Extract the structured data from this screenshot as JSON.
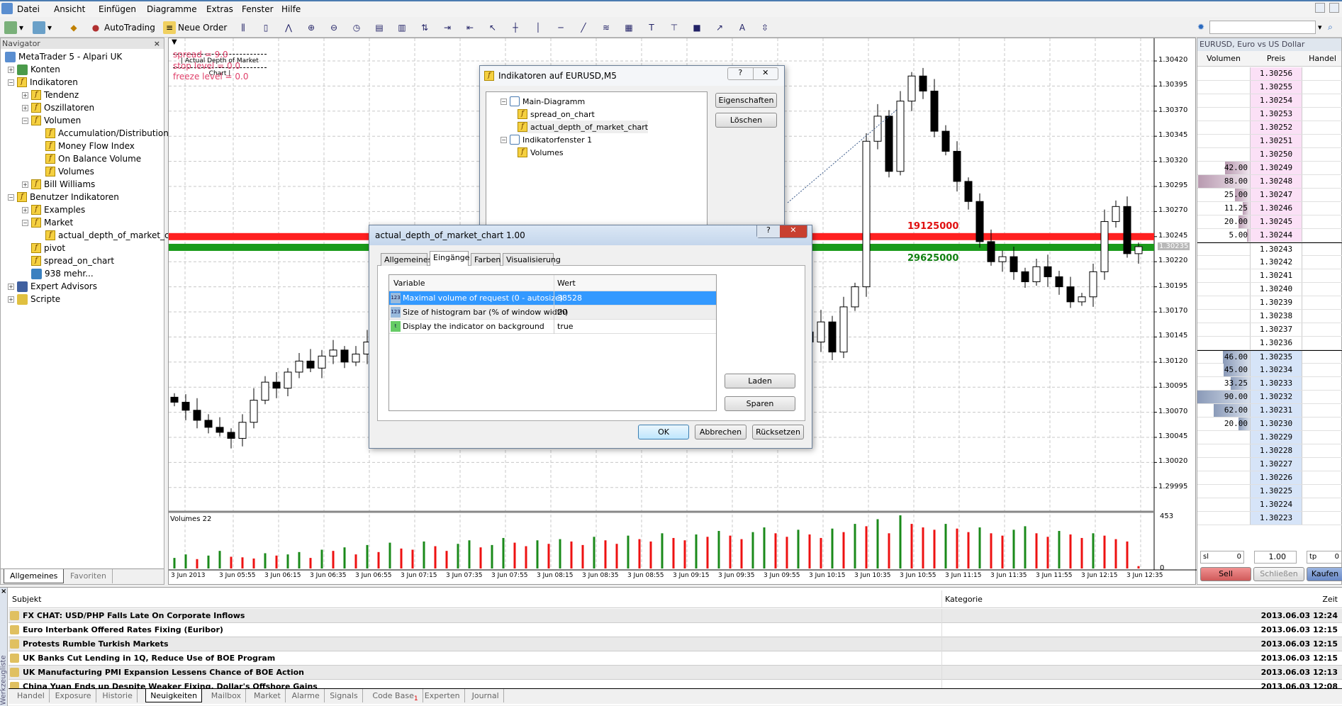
{
  "menu": [
    "Datei",
    "Ansicht",
    "Einfügen",
    "Diagramme",
    "Extras",
    "Fenster",
    "Hilfe"
  ],
  "toolbar": {
    "autotrading": "AutoTrading",
    "new_order": "Neue Order"
  },
  "navigator": {
    "title": "Navigator",
    "items": [
      {
        "label": "MetaTrader 5 - Alpari UK",
        "level": 0,
        "icon": "terminal-icon",
        "toggle": ""
      },
      {
        "label": "Konten",
        "level": 1,
        "icon": "accounts-icon",
        "toggle": "+"
      },
      {
        "label": "Indikatoren",
        "level": 1,
        "icon": "indicator-icon",
        "toggle": "-"
      },
      {
        "label": "Tendenz",
        "level": 2,
        "icon": "indicator-icon",
        "toggle": "+"
      },
      {
        "label": "Oszillatoren",
        "level": 2,
        "icon": "indicator-icon",
        "toggle": "+"
      },
      {
        "label": "Volumen",
        "level": 2,
        "icon": "indicator-icon",
        "toggle": "-"
      },
      {
        "label": "Accumulation/Distribution",
        "level": 3,
        "icon": "indicator-icon",
        "toggle": ""
      },
      {
        "label": "Money Flow Index",
        "level": 3,
        "icon": "indicator-icon",
        "toggle": ""
      },
      {
        "label": "On Balance Volume",
        "level": 3,
        "icon": "indicator-icon",
        "toggle": ""
      },
      {
        "label": "Volumes",
        "level": 3,
        "icon": "indicator-icon",
        "toggle": ""
      },
      {
        "label": "Bill Williams",
        "level": 2,
        "icon": "indicator-icon",
        "toggle": "+"
      },
      {
        "label": "Benutzer Indikatoren",
        "level": 1,
        "icon": "custom-indicator-icon",
        "toggle": "-"
      },
      {
        "label": "Examples",
        "level": 2,
        "icon": "custom-indicator-icon",
        "toggle": "+"
      },
      {
        "label": "Market",
        "level": 2,
        "icon": "custom-indicator-icon",
        "toggle": "-"
      },
      {
        "label": "actual_depth_of_market_chart",
        "level": 3,
        "icon": "custom-indicator-icon",
        "toggle": ""
      },
      {
        "label": "pivot",
        "level": 2,
        "icon": "custom-indicator-icon",
        "toggle": ""
      },
      {
        "label": "spread_on_chart",
        "level": 2,
        "icon": "custom-indicator-icon",
        "toggle": ""
      },
      {
        "label": "938 mehr...",
        "level": 2,
        "icon": "market-icon",
        "toggle": ""
      },
      {
        "label": "Expert Advisors",
        "level": 1,
        "icon": "expert-icon",
        "toggle": "+"
      },
      {
        "label": "Scripte",
        "level": 1,
        "icon": "script-icon",
        "toggle": "+"
      }
    ],
    "tabs": [
      "Allgemeines",
      "Favoriten"
    ]
  },
  "chart": {
    "info_title": "| Actual Depth of Market Chart |",
    "spread": "spread = 9.0",
    "stop_level": "stop level = 0.0",
    "freeze_level": "freeze level = 0.0",
    "ask_volume_label": "19125000",
    "bid_volume_label": "29625000",
    "ask_line_price": 1.30245,
    "bid_line_price": 1.30235,
    "current_price": "1.30235",
    "price_ticks": [
      "1.30420",
      "1.30395",
      "1.30370",
      "1.30345",
      "1.30320",
      "1.30295",
      "1.30270",
      "1.30245",
      "1.30220",
      "1.30195",
      "1.30170",
      "1.30145",
      "1.30120",
      "1.30095",
      "1.30070",
      "1.30045",
      "1.30020",
      "1.29995"
    ],
    "time_ticks": [
      "3 Jun 2013",
      "3 Jun 05:55",
      "3 Jun 06:15",
      "3 Jun 06:35",
      "3 Jun 06:55",
      "3 Jun 07:15",
      "3 Jun 07:35",
      "3 Jun 07:55",
      "3 Jun 08:15",
      "3 Jun 08:35",
      "3 Jun 08:55",
      "3 Jun 09:15",
      "3 Jun 09:35",
      "3 Jun 09:55",
      "3 Jun 10:15",
      "3 Jun 10:35",
      "3 Jun 10:55",
      "3 Jun 11:15",
      "3 Jun 11:35",
      "3 Jun 11:55",
      "3 Jun 12:15",
      "3 Jun 12:35"
    ],
    "closes": [
      1.3008,
      1.30072,
      1.30062,
      1.30055,
      1.3005,
      1.30044,
      1.3006,
      1.30082,
      1.301,
      1.30094,
      1.3011,
      1.30121,
      1.30114,
      1.30126,
      1.30132,
      1.3012,
      1.30128,
      1.3014,
      1.30135,
      1.3015,
      1.30142,
      1.30155,
      1.3016,
      1.3015,
      1.30165,
      1.30172,
      1.3016,
      1.3017,
      1.3018,
      1.30168,
      1.30175,
      1.30185,
      1.30178,
      1.3019,
      1.30182,
      1.30195,
      1.30188,
      1.30176,
      1.30184,
      1.3017,
      1.30178,
      1.30165,
      1.30172,
      1.3016,
      1.30168,
      1.30155,
      1.30162,
      1.3015,
      1.30158,
      1.30165,
      1.30152,
      1.3016,
      1.3017,
      1.30158,
      1.30166,
      1.3015,
      1.3014,
      1.3016,
      1.3013,
      1.30175,
      1.30195,
      1.3034,
      1.30365,
      1.3031,
      1.3038,
      1.30405,
      1.3039,
      1.3035,
      1.3033,
      1.303,
      1.3028,
      1.3024,
      1.3022,
      1.30225,
      1.3021,
      1.302,
      1.30215,
      1.30205,
      1.30195,
      1.3018,
      1.30185,
      1.3021,
      1.3026,
      1.30275,
      1.30228,
      1.30235
    ],
    "volumes_label": "Volumes 22",
    "volumes_max": "453",
    "volumes_min": "0",
    "volumes": [
      90,
      120,
      80,
      110,
      150,
      100,
      95,
      85,
      130,
      110,
      120,
      140,
      90,
      160,
      150,
      180,
      120,
      200,
      140,
      220,
      170,
      160,
      230,
      190,
      150,
      210,
      240,
      180,
      200,
      260,
      220,
      190,
      240,
      210,
      250,
      230,
      200,
      270,
      240,
      210,
      280,
      250,
      230,
      300,
      260,
      240,
      290,
      270,
      320,
      280,
      250,
      310,
      350,
      300,
      270,
      330,
      290,
      260,
      340,
      310,
      380,
      360,
      420,
      300,
      453,
      380,
      350,
      330,
      380,
      340,
      310,
      350,
      300,
      280,
      330,
      360,
      300,
      270,
      320,
      290,
      260,
      300,
      280,
      250,
      230,
      20
    ],
    "colors": {
      "bull": "#ffffff",
      "bear": "#000000",
      "ask_line": "#ff2020",
      "bid_line": "#1a9a1a",
      "vol_up": "#1a8a1a",
      "vol_down": "#ee1111",
      "info_text": "#e0406a"
    }
  },
  "depth": {
    "title": "EURUSD, Euro vs US Dollar",
    "columns": [
      "Volumen",
      "Preis",
      "Handel"
    ],
    "rows": [
      {
        "price": "1.30256",
        "vol": "",
        "side": "ask",
        "fill": 0
      },
      {
        "price": "1.30255",
        "vol": "",
        "side": "ask",
        "fill": 0
      },
      {
        "price": "1.30254",
        "vol": "",
        "side": "ask",
        "fill": 0
      },
      {
        "price": "1.30253",
        "vol": "",
        "side": "ask",
        "fill": 0
      },
      {
        "price": "1.30252",
        "vol": "",
        "side": "ask",
        "fill": 0
      },
      {
        "price": "1.30251",
        "vol": "",
        "side": "ask",
        "fill": 0
      },
      {
        "price": "1.30250",
        "vol": "",
        "side": "ask",
        "fill": 0
      },
      {
        "price": "1.30249",
        "vol": "42.00",
        "side": "ask",
        "fill": 0.47
      },
      {
        "price": "1.30248",
        "vol": "88.00",
        "side": "ask",
        "fill": 0.98
      },
      {
        "price": "1.30247",
        "vol": "25.00",
        "side": "ask",
        "fill": 0.28
      },
      {
        "price": "1.30246",
        "vol": "11.25",
        "side": "ask",
        "fill": 0.13
      },
      {
        "price": "1.30245",
        "vol": "20.00",
        "side": "ask",
        "fill": 0.22
      },
      {
        "price": "1.30244",
        "vol": "5.00",
        "side": "ask",
        "fill": 0.06
      },
      {
        "price": "1.30243",
        "vol": "",
        "side": "none",
        "fill": 0
      },
      {
        "price": "1.30242",
        "vol": "",
        "side": "none",
        "fill": 0
      },
      {
        "price": "1.30241",
        "vol": "",
        "side": "none",
        "fill": 0
      },
      {
        "price": "1.30240",
        "vol": "",
        "side": "none",
        "fill": 0
      },
      {
        "price": "1.30239",
        "vol": "",
        "side": "none",
        "fill": 0
      },
      {
        "price": "1.30238",
        "vol": "",
        "side": "none",
        "fill": 0
      },
      {
        "price": "1.30237",
        "vol": "",
        "side": "none",
        "fill": 0
      },
      {
        "price": "1.30236",
        "vol": "",
        "side": "none",
        "fill": 0
      },
      {
        "price": "1.30235",
        "vol": "46.00",
        "side": "bid",
        "fill": 0.51
      },
      {
        "price": "1.30234",
        "vol": "45.00",
        "side": "bid",
        "fill": 0.5
      },
      {
        "price": "1.30233",
        "vol": "33.25",
        "side": "bid",
        "fill": 0.37
      },
      {
        "price": "1.30232",
        "vol": "90.00",
        "side": "bid",
        "fill": 1.0
      },
      {
        "price": "1.30231",
        "vol": "62.00",
        "side": "bid",
        "fill": 0.69
      },
      {
        "price": "1.30230",
        "vol": "20.00",
        "side": "bid",
        "fill": 0.22
      },
      {
        "price": "1.30229",
        "vol": "",
        "side": "bid",
        "fill": 0
      },
      {
        "price": "1.30228",
        "vol": "",
        "side": "bid",
        "fill": 0
      },
      {
        "price": "1.30227",
        "vol": "",
        "side": "bid",
        "fill": 0
      },
      {
        "price": "1.30226",
        "vol": "",
        "side": "bid",
        "fill": 0
      },
      {
        "price": "1.30225",
        "vol": "",
        "side": "bid",
        "fill": 0
      },
      {
        "price": "1.30224",
        "vol": "",
        "side": "bid",
        "fill": 0
      },
      {
        "price": "1.30223",
        "vol": "",
        "side": "bid",
        "fill": 0
      }
    ],
    "sl_label": "sl",
    "sl_value": "0",
    "lot": "1.00",
    "tp_label": "tp",
    "tp_value": "0",
    "sell": "Sell",
    "close": "Schließen",
    "buy": "Kaufen"
  },
  "indicators_dialog": {
    "title": "Indikatoren auf EURUSD,M5",
    "tree": [
      {
        "label": "Main-Diagramm",
        "level": 0,
        "icon": "window-icon"
      },
      {
        "label": "spread_on_chart",
        "level": 1,
        "icon": "custom-indicator-icon"
      },
      {
        "label": "actual_depth_of_market_chart",
        "level": 1,
        "icon": "custom-indicator-icon"
      },
      {
        "label": "Indikatorfenster 1",
        "level": 0,
        "icon": "window-icon"
      },
      {
        "label": "Volumes",
        "level": 1,
        "icon": "indicator-icon"
      }
    ],
    "properties": "Eigenschaften",
    "delete": "Löschen"
  },
  "props_dialog": {
    "title": "actual_depth_of_market_chart 1.00",
    "tabs": [
      "Allgemeines",
      "Eingänge",
      "Farben",
      "Visualisierung"
    ],
    "active_tab": 1,
    "columns": [
      "Variable",
      "Wert"
    ],
    "rows": [
      {
        "name": "Maximal volume of request (0 - autosize)",
        "value": "38528",
        "type": "int",
        "selected": true
      },
      {
        "name": "Size of histogram bar (% of window width)",
        "value": "20",
        "type": "int",
        "selected": false
      },
      {
        "name": "Display the indicator on background",
        "value": "true",
        "type": "bool",
        "selected": false
      }
    ],
    "load": "Laden",
    "save": "Sparen",
    "ok": "OK",
    "cancel": "Abbrechen",
    "reset": "Rücksetzen"
  },
  "toolbox": {
    "side_label": "Werkzeugliste",
    "columns": [
      "Subjekt",
      "Kategorie",
      "Zeit"
    ],
    "news": [
      {
        "subject": "FX CHAT: USD/PHP Falls Late On Corporate Inflows",
        "category": "",
        "time": "2013.06.03 12:24"
      },
      {
        "subject": "Euro Interbank Offered Rates Fixing (Euribor)",
        "category": "",
        "time": "2013.06.03 12:15"
      },
      {
        "subject": "Protests Rumble Turkish Markets",
        "category": "",
        "time": "2013.06.03 12:15"
      },
      {
        "subject": "UK Banks Cut Lending in 1Q, Reduce Use of BOE Program",
        "category": "",
        "time": "2013.06.03 12:15"
      },
      {
        "subject": "UK Manufacturing PMI Expansion Lessens Chance of BOE Action",
        "category": "",
        "time": "2013.06.03 12:13"
      },
      {
        "subject": "China Yuan Ends up Despite Weaker Fixing, Dollar's Offshore Gains",
        "category": "",
        "time": "2013.06.03 12:08"
      }
    ],
    "tabs": [
      "Handel",
      "Exposure",
      "Historie",
      "Neuigkeiten",
      "Mailbox",
      "Market",
      "Alarme",
      "Signals",
      "Code Base",
      "Experten",
      "Journal"
    ],
    "active_tab": 3,
    "code_base_badge": "1"
  }
}
